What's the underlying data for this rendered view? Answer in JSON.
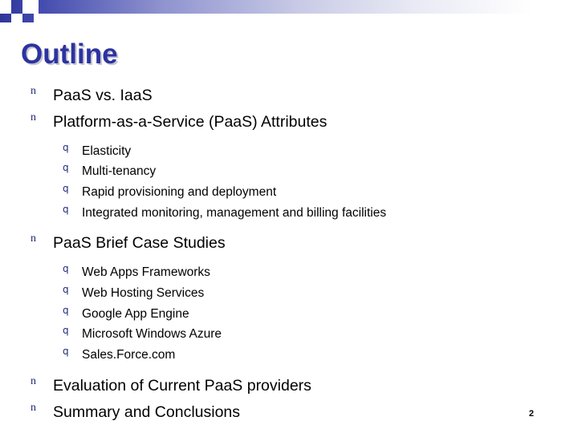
{
  "slide": {
    "title": "Outline",
    "page_number": "2",
    "accent_color": "#2c33a0",
    "bullets": {
      "level1_glyph": "n",
      "level2_glyph": "q"
    },
    "outline": [
      {
        "level": 1,
        "text": "PaaS vs. IaaS"
      },
      {
        "level": 1,
        "text": "Platform-as-a-Service (PaaS) Attributes"
      },
      {
        "level": 2,
        "text": "Elasticity"
      },
      {
        "level": 2,
        "text": "Multi-tenancy"
      },
      {
        "level": 2,
        "text": "Rapid provisioning and deployment"
      },
      {
        "level": 2,
        "text": "Integrated monitoring, management and billing facilities"
      },
      {
        "level": 1,
        "text": "PaaS Brief Case Studies"
      },
      {
        "level": 2,
        "text": "Web Apps Frameworks"
      },
      {
        "level": 2,
        "text": "Web Hosting Services"
      },
      {
        "level": 2,
        "text": "Google App Engine"
      },
      {
        "level": 2,
        "text": "Microsoft Windows Azure"
      },
      {
        "level": 2,
        "text": "Sales.Force.com"
      },
      {
        "level": 1,
        "text": "Evaluation of Current PaaS providers"
      },
      {
        "level": 1,
        "text": "Summary and Conclusions"
      }
    ]
  }
}
